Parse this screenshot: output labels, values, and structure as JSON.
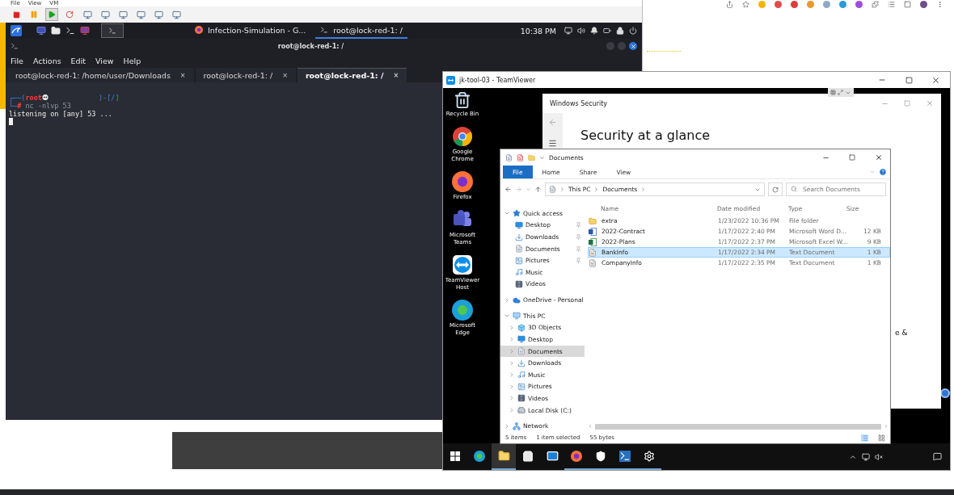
{
  "vm_menu": [
    "File",
    "View",
    "VM"
  ],
  "kali_panel": {
    "tasks": [
      {
        "kind": "browser",
        "label": "Infection-Simulation - G...",
        "selected": false
      },
      {
        "kind": "terminal",
        "label": "root@lock-red-1: /",
        "selected": true
      }
    ],
    "clock": "10:38 PM"
  },
  "terminal": {
    "title": "root@lock-red-1: /",
    "menu": [
      "File",
      "Actions",
      "Edit",
      "View",
      "Help"
    ],
    "tabs": [
      {
        "label": "root@lock-red-1: /home/user/Downloads",
        "close": "×",
        "selected": false
      },
      {
        "label": "root@lock-red-1: /",
        "close": "×",
        "selected": false
      },
      {
        "label": "root@lock-red-1: /",
        "close": "×",
        "selected": true
      }
    ],
    "prompt": {
      "head": "┌──(",
      "user": "root",
      "tail": ")-[/]",
      "corner": "└─",
      "sign": "#",
      "command": "nc -nlvp 53"
    },
    "output": "listening on [any] 53 ..."
  },
  "teamviewer": {
    "title": "jk-tool-03 - TeamViewer",
    "desktop_icons": [
      {
        "kind": "recycle",
        "label": "Recycle Bin"
      },
      {
        "kind": "chrome",
        "label": "Google Chrome"
      },
      {
        "kind": "firefox",
        "label": "Firefox"
      },
      {
        "kind": "teams",
        "label": "Microsoft Teams"
      },
      {
        "kind": "teamviewer",
        "label": "TeamViewer Host"
      },
      {
        "kind": "edge",
        "label": "Microsoft Edge"
      }
    ],
    "security": {
      "title": "Windows Security",
      "heading": "Security at a glance",
      "fragment": "e &"
    },
    "explorer": {
      "title": "Documents",
      "ribbon_tabs": [
        {
          "label": "File",
          "selected": true
        },
        {
          "label": "Home",
          "selected": false
        },
        {
          "label": "Share",
          "selected": false
        },
        {
          "label": "View",
          "selected": false
        }
      ],
      "address": [
        "This PC",
        "Documents"
      ],
      "search": {
        "placeholder": "Search Documents"
      },
      "nav": [
        {
          "label": "Quick access",
          "kind": "star",
          "expanded": true,
          "selected": false,
          "children": [
            {
              "label": "Desktop",
              "kind": "desktop",
              "pinned": true,
              "selected": false
            },
            {
              "label": "Downloads",
              "kind": "download",
              "pinned": true,
              "selected": false
            },
            {
              "label": "Documents",
              "kind": "documents",
              "pinned": true,
              "selected": false
            },
            {
              "label": "Pictures",
              "kind": "pictures",
              "pinned": true,
              "selected": false
            },
            {
              "label": "Music",
              "kind": "music",
              "pinned": false,
              "selected": false
            },
            {
              "label": "Videos",
              "kind": "videos",
              "pinned": false,
              "selected": false
            }
          ]
        },
        {
          "label": "OneDrive - Personal",
          "kind": "cloud",
          "expanded": false,
          "selected": false
        },
        {
          "label": "This PC",
          "kind": "pc",
          "expanded": true,
          "selected": false,
          "children": [
            {
              "label": "3D Objects",
              "kind": "objects",
              "expanded": false,
              "selected": false
            },
            {
              "label": "Desktop",
              "kind": "desktop",
              "expanded": false,
              "selected": false
            },
            {
              "label": "Documents",
              "kind": "documents",
              "expanded": false,
              "selected": true
            },
            {
              "label": "Downloads",
              "kind": "download",
              "expanded": false,
              "selected": false
            },
            {
              "label": "Music",
              "kind": "music",
              "expanded": false,
              "selected": false
            },
            {
              "label": "Pictures",
              "kind": "pictures",
              "expanded": false,
              "selected": false
            },
            {
              "label": "Videos",
              "kind": "videos",
              "expanded": false,
              "selected": false
            },
            {
              "label": "Local Disk (C:)",
              "kind": "disk",
              "expanded": false,
              "selected": false
            }
          ]
        },
        {
          "label": "Network",
          "kind": "network",
          "expanded": false,
          "selected": false
        }
      ],
      "columns": [
        "Name",
        "Date modified",
        "Type",
        "Size"
      ],
      "rows": [
        {
          "kind": "folder",
          "name": "extra",
          "date": "1/23/2022 10:36 PM",
          "type": "File folder",
          "selected": false
        },
        {
          "kind": "word",
          "name": "2022-Contract",
          "date": "1/17/2022 2:40 PM",
          "type": "Microsoft Word D...",
          "size": "12 KB",
          "selected": false
        },
        {
          "kind": "excel",
          "name": "2022-Plans",
          "date": "1/17/2022 2:37 PM",
          "type": "Microsoft Excel W...",
          "size": "9 KB",
          "selected": false
        },
        {
          "kind": "text",
          "name": "BankInfo",
          "date": "1/17/2022 2:34 PM",
          "type": "Text Document",
          "size": "1 KB",
          "selected": true
        },
        {
          "kind": "text",
          "name": "CompanyInfo",
          "date": "1/17/2022 2:35 PM",
          "type": "Text Document",
          "size": "1 KB",
          "selected": false
        }
      ],
      "status": [
        "5 items",
        "1 item selected",
        "55 bytes"
      ]
    },
    "taskbar": [
      {
        "kind": "start",
        "open": false,
        "selected": false
      },
      {
        "kind": "edge",
        "open": false,
        "selected": false
      },
      {
        "kind": "explorer",
        "open": true,
        "selected": true
      },
      {
        "kind": "store",
        "open": false,
        "selected": false
      },
      {
        "kind": "mail",
        "open": false,
        "selected": false
      },
      {
        "kind": "firefox",
        "open": true,
        "selected": false
      },
      {
        "kind": "security",
        "open": true,
        "selected": false
      },
      {
        "kind": "powershell",
        "open": true,
        "selected": false
      },
      {
        "kind": "settings",
        "open": true,
        "selected": false
      }
    ]
  }
}
